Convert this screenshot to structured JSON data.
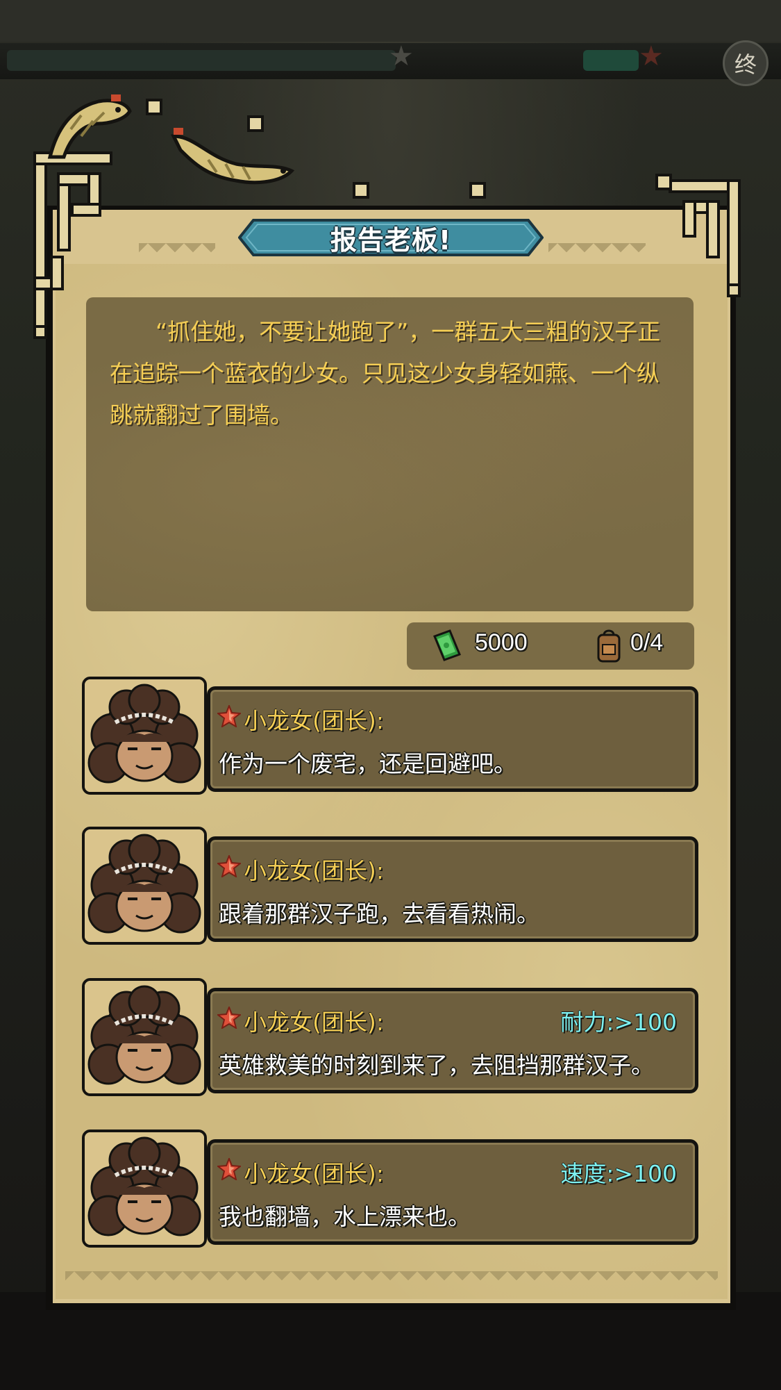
{
  "top": {
    "end_label": "终"
  },
  "dialog": {
    "title": "报告老板!",
    "story": "“抓住她，不要让她跑了”，一群五大三粗的汉子正在追踪一个蓝衣的少女。只见这少女身轻如燕、一个纵跳就翻过了围墙。"
  },
  "resources": {
    "money": "5000",
    "money_icon": "cash-icon",
    "bag": "0/4",
    "bag_icon": "backpack-icon"
  },
  "choices": [
    {
      "speaker": "小龙女(团长):",
      "text": "作为一个废宅，还是回避吧。",
      "requirement": ""
    },
    {
      "speaker": "小龙女(团长):",
      "text": "跟着那群汉子跑，去看看热闹。",
      "requirement": ""
    },
    {
      "speaker": "小龙女(团长):",
      "text": "英雄救美的时刻到来了，去阻挡那群汉子。",
      "requirement": "耐力:>100"
    },
    {
      "speaker": "小龙女(团长):",
      "text": "我也翻墙，水上漂来也。",
      "requirement": "速度:>100"
    }
  ],
  "colors": {
    "title_banner": "#3f8da0",
    "story_text": "#f6cf55",
    "requirement_text": "#7ef2f2",
    "panel": "#ceb97f"
  }
}
